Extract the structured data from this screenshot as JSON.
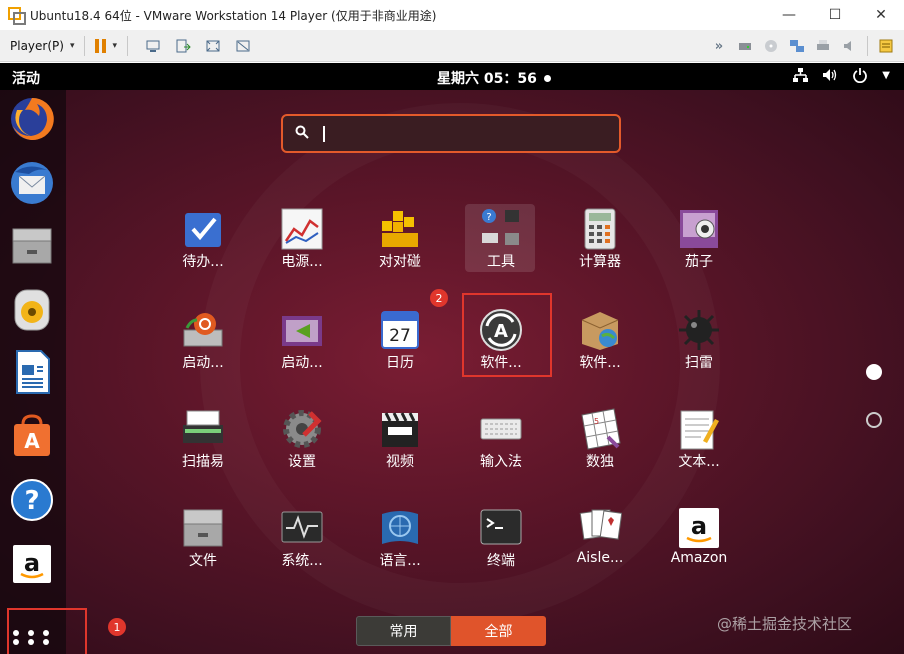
{
  "window": {
    "title": "Ubuntu18.4 64位 - VMware Workstation 14 Player (仅用于非商业用途)",
    "minimize": "—",
    "maximize": "☐",
    "close": "✕"
  },
  "toolbar": {
    "player_menu": "Player(P)",
    "caret": "▾"
  },
  "topbar": {
    "activities": "活动",
    "clock": "星期六 05：56"
  },
  "search": {
    "value": "",
    "placeholder": ""
  },
  "annotations": {
    "badge_1": "1",
    "badge_2": "2"
  },
  "apps": [
    {
      "label": "待办...",
      "icon": "todo-icon"
    },
    {
      "label": "电源...",
      "icon": "power-statistics-icon"
    },
    {
      "label": "对对碰",
      "icon": "swell-foop-icon"
    },
    {
      "label": "工具",
      "icon": "utilities-folder-icon"
    },
    {
      "label": "计算器",
      "icon": "calculator-icon"
    },
    {
      "label": "茄子",
      "icon": "cheese-icon"
    },
    {
      "label": "启动...",
      "icon": "startup-applications-icon"
    },
    {
      "label": "启动...",
      "icon": "startup-disk-creator-icon"
    },
    {
      "label": "日历",
      "icon": "calendar-icon"
    },
    {
      "label": "软件...",
      "icon": "software-updater-icon"
    },
    {
      "label": "软件...",
      "icon": "software-properties-icon"
    },
    {
      "label": "扫雷",
      "icon": "mines-icon"
    },
    {
      "label": "扫描易",
      "icon": "scanner-icon"
    },
    {
      "label": "设置",
      "icon": "settings-icon"
    },
    {
      "label": "视频",
      "icon": "videos-icon"
    },
    {
      "label": "输入法",
      "icon": "keyboard-input-icon"
    },
    {
      "label": "数独",
      "icon": "sudoku-icon"
    },
    {
      "label": "文本...",
      "icon": "text-editor-icon"
    },
    {
      "label": "文件",
      "icon": "files-icon"
    },
    {
      "label": "系统...",
      "icon": "system-monitor-icon"
    },
    {
      "label": "语言...",
      "icon": "language-support-icon"
    },
    {
      "label": "终端",
      "icon": "terminal-icon"
    },
    {
      "label": "Aisle...",
      "icon": "aisleriot-icon"
    },
    {
      "label": "Amazon",
      "icon": "amazon-icon"
    }
  ],
  "calendar_day": "27",
  "tabs": {
    "common": "常用",
    "all": "全部"
  },
  "watermark": "@稀土掘金技术社区",
  "colors": {
    "accent": "#e0542b",
    "annotation": "#e0362c"
  }
}
